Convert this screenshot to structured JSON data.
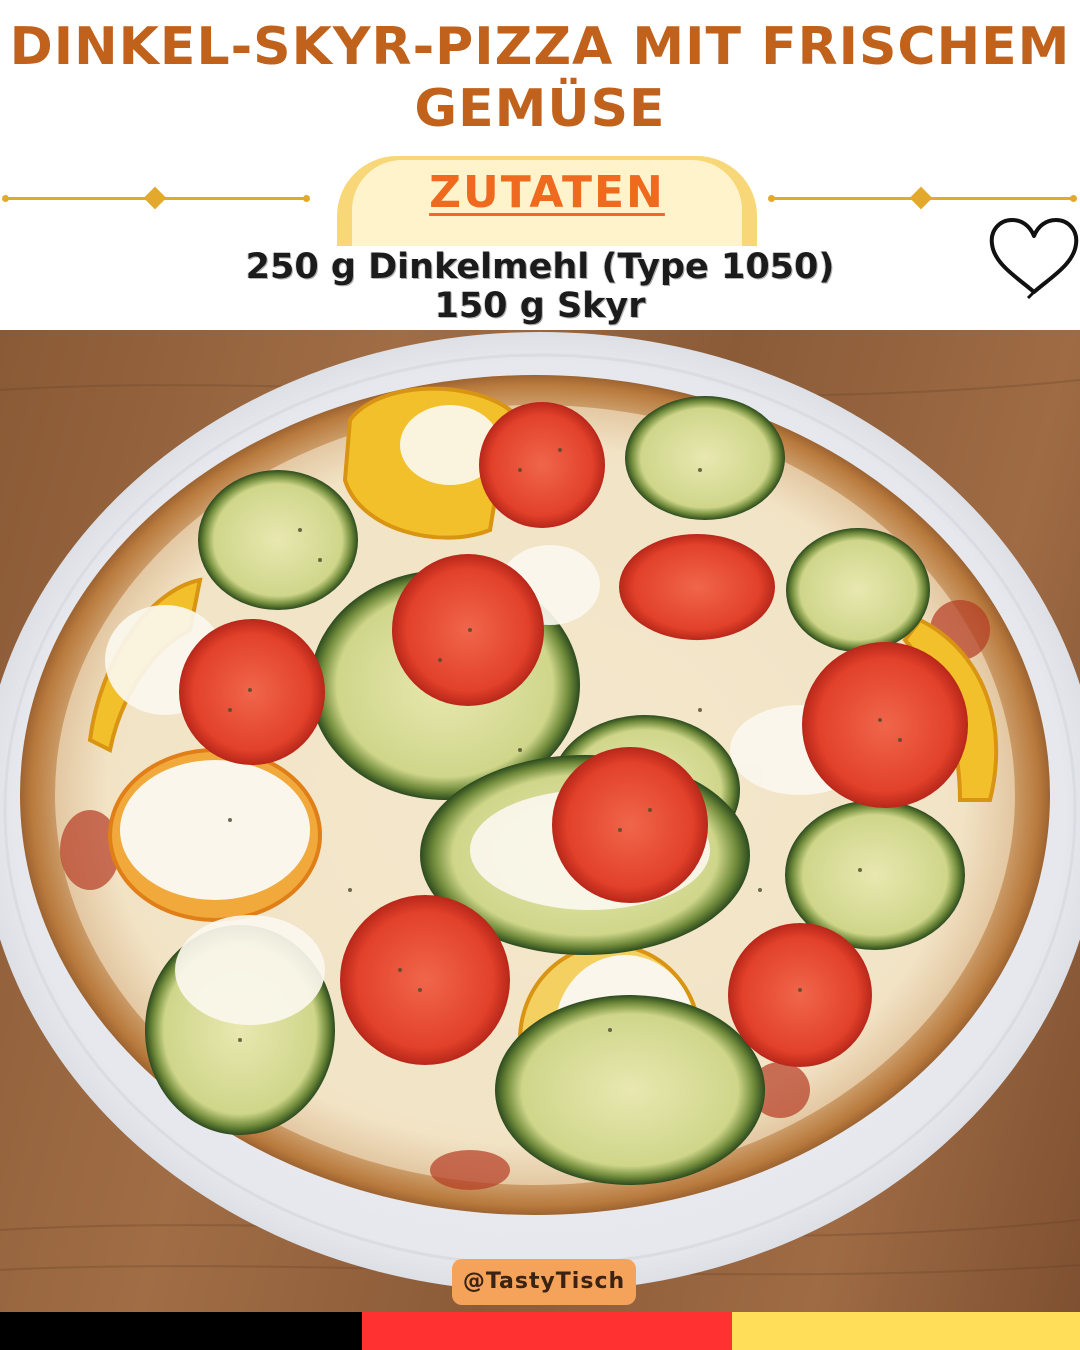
{
  "title": {
    "line1": "Dinkel-Skyr-Pizza mit frischem",
    "line2": "Gemüse",
    "color": "#c0621c"
  },
  "section_label": "ZUTATEN",
  "ingredients": [
    "250 g Dinkelmehl (Type 1050)",
    "150 g Skyr"
  ],
  "photo": {
    "subject": "pizza with zucchini, tomato, yellow pepper and mozzarella on a white plate"
  },
  "handle": "@TastyTisch",
  "icons": {
    "heart": "heart-outline-icon"
  },
  "flag_colors": [
    "#000000",
    "#ff3131",
    "#ffde59"
  ]
}
